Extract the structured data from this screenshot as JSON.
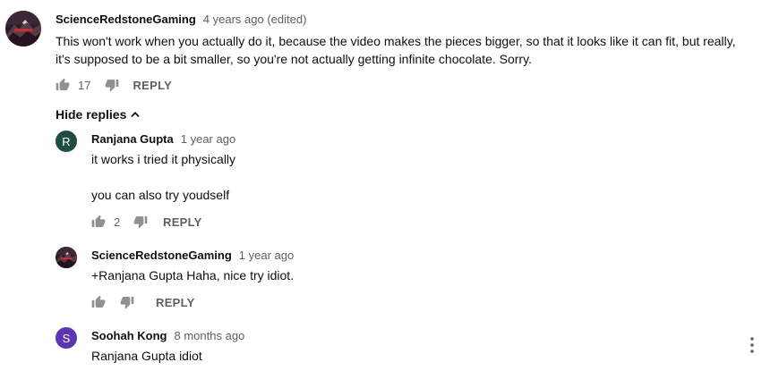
{
  "comment": {
    "author": "ScienceRedstoneGaming",
    "time": "4 years ago (edited)",
    "text_line1": "This won't work when you actually do it, because the video makes the pieces bigger, so that it looks like it can fit, but really,",
    "text_line2": "it's supposed to be a bit smaller, so you're not actually getting infinite chocolate. Sorry.",
    "likes": "17",
    "reply_label": "REPLY"
  },
  "hide_replies_label": "Hide replies",
  "replies": [
    {
      "author": "Ranjana Gupta",
      "time": "1 year ago",
      "avatar_letter": "R",
      "avatar_color": "#1e4d45",
      "text_line1": "it works i tried it physically",
      "text_line2": "you can also try youdself",
      "likes": "2",
      "reply_label": "REPLY"
    },
    {
      "author": "ScienceRedstoneGaming",
      "time": "1 year ago",
      "text_line1": "+Ranjana Gupta Haha, nice try idiot.",
      "likes": "",
      "reply_label": "REPLY"
    },
    {
      "author": "Soohah Kong",
      "time": "8 months ago",
      "avatar_letter": "S",
      "avatar_color": "#5e35b1",
      "text_line1": "Ranjana Gupta idiot"
    }
  ],
  "icons": {
    "like": "thumb-up-icon",
    "dislike": "thumb-down-icon",
    "chevron": "chevron-up-icon",
    "more": "more-vertical-icon"
  },
  "colors": {
    "text_primary": "#0f0f0f",
    "text_secondary": "#606060",
    "icon": "#909090"
  }
}
